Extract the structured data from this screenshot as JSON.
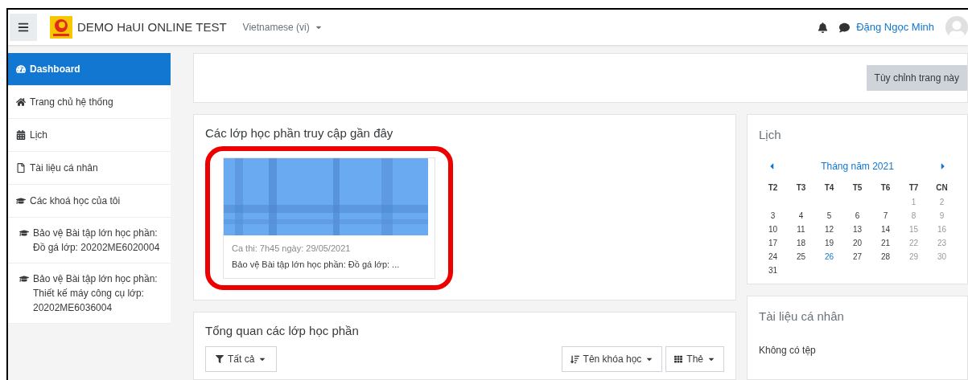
{
  "navbar": {
    "site_name": "DEMO HaUI ONLINE TEST",
    "language": "Vietnamese (vi)",
    "user_name": "Đặng Ngọc Minh"
  },
  "sidebar": {
    "items": [
      {
        "label": "Dashboard",
        "selected": true
      },
      {
        "label": "Trang chủ hệ thống",
        "selected": false
      },
      {
        "label": "Lịch",
        "selected": false
      },
      {
        "label": "Tài liệu cá nhân",
        "selected": false
      },
      {
        "label": "Các khoá học của tôi",
        "selected": false
      },
      {
        "label": "Bảo vệ Bài tập lớn học phần: Đồ gá lớp: 20202ME6020004",
        "selected": false
      },
      {
        "label": "Bảo vệ Bài tập lớn học phần: Thiết kế máy công cụ lớp: 20202ME6036004",
        "selected": false
      }
    ]
  },
  "customize_button": "Tùy chỉnh trang này",
  "recent_courses": {
    "title": "Các lớp học phần truy cập gần đây",
    "highlighted": true,
    "cards": [
      {
        "subtitle": "Ca thi: 7h45 ngày: 29/05/2021",
        "name": "Bảo vệ Bài tập lớn học phần: Đồ gá lớp: ..."
      }
    ]
  },
  "course_overview": {
    "title": "Tổng quan các lớp học phần",
    "filter": "Tất cả",
    "sort": "Tên khóa học",
    "view": "Thẻ"
  },
  "calendar": {
    "title": "Lịch",
    "month": "Tháng năm 2021",
    "weekdays": [
      "T2",
      "T3",
      "T4",
      "T5",
      "T6",
      "T7",
      "CN"
    ],
    "weeks": [
      [
        {
          "day": "1",
          "kind": "weekend"
        },
        {
          "day": "2",
          "kind": "weekend"
        }
      ],
      [
        {
          "day": "3",
          "kind": "weekday"
        },
        {
          "day": "4",
          "kind": "weekday"
        },
        {
          "day": "5",
          "kind": "weekday"
        },
        {
          "day": "6",
          "kind": "weekday"
        },
        {
          "day": "7",
          "kind": "weekday"
        },
        {
          "day": "8",
          "kind": "weekend"
        },
        {
          "day": "9",
          "kind": "weekend"
        }
      ],
      [
        {
          "day": "10",
          "kind": "weekday"
        },
        {
          "day": "11",
          "kind": "weekday"
        },
        {
          "day": "12",
          "kind": "weekday"
        },
        {
          "day": "13",
          "kind": "weekday"
        },
        {
          "day": "14",
          "kind": "weekday"
        },
        {
          "day": "15",
          "kind": "weekend"
        },
        {
          "day": "16",
          "kind": "weekend"
        }
      ],
      [
        {
          "day": "17",
          "kind": "weekday"
        },
        {
          "day": "18",
          "kind": "weekday"
        },
        {
          "day": "19",
          "kind": "weekday"
        },
        {
          "day": "20",
          "kind": "weekday"
        },
        {
          "day": "21",
          "kind": "weekday"
        },
        {
          "day": "22",
          "kind": "weekend"
        },
        {
          "day": "23",
          "kind": "weekend"
        }
      ],
      [
        {
          "day": "24",
          "kind": "weekday"
        },
        {
          "day": "25",
          "kind": "weekday"
        },
        {
          "day": "26",
          "kind": "today"
        },
        {
          "day": "27",
          "kind": "weekday"
        },
        {
          "day": "28",
          "kind": "weekday"
        },
        {
          "day": "29",
          "kind": "weekend"
        },
        {
          "day": "30",
          "kind": "weekend"
        }
      ],
      [
        {
          "day": "31",
          "kind": "weekday"
        }
      ]
    ]
  },
  "private_files": {
    "title": "Tài liệu cá nhân",
    "empty_text": "Không có tệp"
  }
}
